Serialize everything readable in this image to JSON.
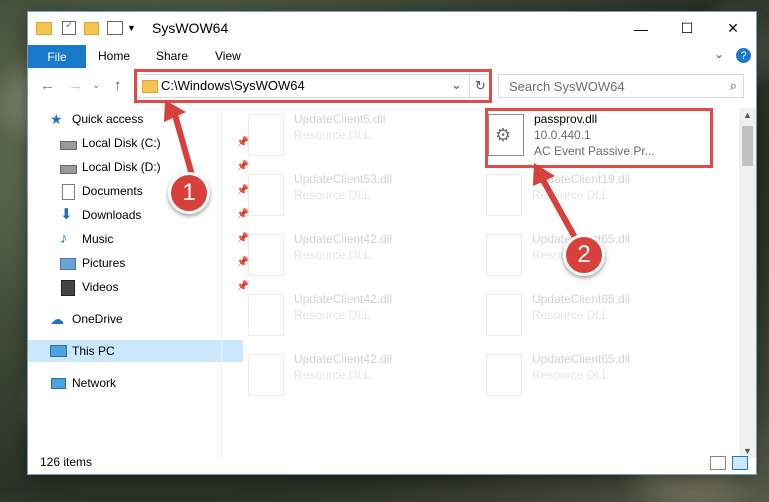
{
  "window": {
    "title": "SysWOW64"
  },
  "controls": {
    "minimize": "—",
    "maximize": "☐",
    "close": "✕",
    "collapse": "⌄",
    "help": "?"
  },
  "ribbon": {
    "tabs": [
      "File",
      "Home",
      "Share",
      "View"
    ]
  },
  "nav": {
    "address": "C:\\Windows\\SysWOW64",
    "search_placeholder": "Search SysWOW64"
  },
  "sidebar": {
    "items": [
      {
        "label": "Quick access",
        "icon": "star-icon"
      },
      {
        "label": "Local Disk (C:)",
        "icon": "drive-icon",
        "pinned": true
      },
      {
        "label": "Local Disk (D:)",
        "icon": "drive-icon",
        "pinned": true
      },
      {
        "label": "Documents",
        "icon": "documents-icon",
        "pinned": true
      },
      {
        "label": "Downloads",
        "icon": "downloads-icon",
        "pinned": true
      },
      {
        "label": "Music",
        "icon": "music-icon",
        "pinned": true
      },
      {
        "label": "Pictures",
        "icon": "pictures-icon",
        "pinned": true
      },
      {
        "label": "Videos",
        "icon": "videos-icon",
        "pinned": true
      },
      {
        "label": "OneDrive",
        "icon": "onedrive-icon"
      },
      {
        "label": "This PC",
        "icon": "this-pc-icon"
      },
      {
        "label": "Network",
        "icon": "network-icon"
      }
    ]
  },
  "files": {
    "featured": {
      "name": "passprov.dll",
      "version": "10.0.440.1",
      "description": "AC Event Passive Pr..."
    },
    "background": [
      {
        "name": "UpdateClient5.dll",
        "type": "Resource DLL"
      },
      {
        "name": "UpdateClient53.dll",
        "type": "Resource DLL"
      },
      {
        "name": "UpdateClient19.dll",
        "type": "Resource DLL"
      },
      {
        "name": "UpdateClient42.dll",
        "type": "Resource DLL"
      },
      {
        "name": "UpdateClient65.dll",
        "type": "Resource DLL"
      },
      {
        "name": "UpdateClient42.dll",
        "type": "Resource DLL"
      },
      {
        "name": "UpdateClient65.dll",
        "type": "Resource DLL"
      },
      {
        "name": "UpdateClient42.dll",
        "type": "Resource DLL"
      },
      {
        "name": "UpdateClient65.dll",
        "type": "Resource DLL"
      }
    ]
  },
  "status": {
    "items_count": "126 items"
  },
  "annotations": {
    "step1": "1",
    "step2": "2",
    "color": "#d8403c"
  }
}
